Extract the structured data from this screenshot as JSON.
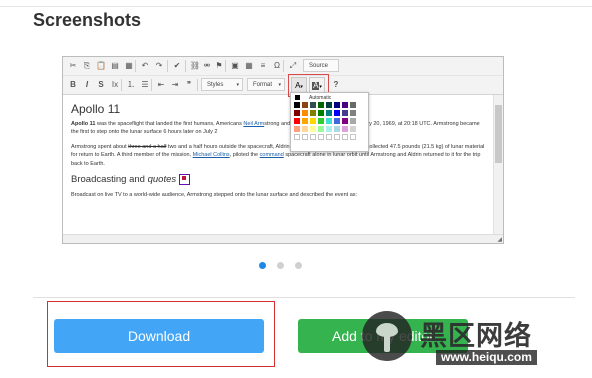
{
  "page": {
    "heading": "Screenshots"
  },
  "editor": {
    "toolbar_row1": [
      {
        "name": "cut-icon",
        "glyph": "✂"
      },
      {
        "name": "copy-icon",
        "glyph": "⎘"
      },
      {
        "name": "paste-icon",
        "glyph": "📋"
      },
      {
        "name": "paste-text-icon",
        "glyph": "▤"
      },
      {
        "name": "paste-word-icon",
        "glyph": "▦"
      },
      {
        "name": "undo-icon",
        "glyph": "↶"
      },
      {
        "name": "redo-icon",
        "glyph": "↷"
      },
      {
        "name": "spellcheck-icon",
        "glyph": "✔"
      },
      {
        "name": "link-icon",
        "glyph": "⛓"
      },
      {
        "name": "unlink-icon",
        "glyph": "⚮"
      },
      {
        "name": "anchor-icon",
        "glyph": "⚑"
      },
      {
        "name": "image-icon",
        "glyph": "▣"
      },
      {
        "name": "table-icon",
        "glyph": "▦"
      },
      {
        "name": "horizontal-line-icon",
        "glyph": "≡"
      },
      {
        "name": "special-char-icon",
        "glyph": "Ω"
      },
      {
        "name": "maximize-icon",
        "glyph": "⤢"
      }
    ],
    "source_label": "Source",
    "toolbar_row2": [
      {
        "name": "bold-icon",
        "glyph": "B"
      },
      {
        "name": "italic-icon",
        "glyph": "I"
      },
      {
        "name": "strike-icon",
        "glyph": "S"
      },
      {
        "name": "remove-format-icon",
        "glyph": "Ix"
      },
      {
        "name": "numbered-list-icon",
        "glyph": "⒈"
      },
      {
        "name": "bulleted-list-icon",
        "glyph": "☰"
      },
      {
        "name": "outdent-icon",
        "glyph": "⇤"
      },
      {
        "name": "indent-icon",
        "glyph": "⇥"
      },
      {
        "name": "blockquote-icon",
        "glyph": "❞"
      }
    ],
    "styles_label": "Styles",
    "format_label": "Format",
    "text_color_glyph": "A",
    "bg_color_glyph": "A",
    "help_glyph": "?",
    "palette": {
      "auto_label": "Automatic",
      "colors": [
        "#000000",
        "#8b4513",
        "#2f4f4f",
        "#006400",
        "#004040",
        "#000080",
        "#4b0082",
        "#696969",
        "#800000",
        "#ff8c00",
        "#808000",
        "#008000",
        "#008080",
        "#0000ff",
        "#483d8b",
        "#808080",
        "#ff0000",
        "#ffa500",
        "#ffd700",
        "#32cd32",
        "#40e0d0",
        "#4169e1",
        "#800080",
        "#a9a9a9",
        "#ffa07a",
        "#ffd59a",
        "#ffff99",
        "#98fb98",
        "#afeeee",
        "#add8e6",
        "#dda0dd",
        "#d3d3d3",
        "",
        "",
        "",
        "",
        "",
        "",
        "",
        ""
      ]
    },
    "doc": {
      "title": "Apollo 11",
      "p1_bold": "Apollo 11",
      "p1_a": " was the spaceflight that landed the first humans, Americans ",
      "p1_link1": "Neil Arm",
      "p1_b": "strong and Buzz Aldrin, on the Moon on July 20, 1969, at 20:18 UTC. Armstrong became the first to step onto the lunar surface 6 hours later on July 2",
      "p2_a": "Armstrong spent about ",
      "p2_strike": "three and a half",
      "p2_b": " two and a half hours outside the spacecraft, Aldrin slightly less; and together they collected 47.5 pounds (21.5 kg) of lunar material for return to Earth. A third member of the mission, ",
      "p2_link1": "Michael Collins",
      "p2_c": ", piloted the ",
      "p2_link2": "command",
      "p2_d": " spacecraft alone in lunar orbit until Armstrong and Aldrin returned to it for the trip back to Earth.",
      "h2_a": "Broadcasting and ",
      "h2_em": "quotes",
      "p3": "Broadcast on live TV to a world-wide audience, Armstrong stepped onto the lunar surface and described the event as:"
    }
  },
  "carousel": {
    "active_index": 0,
    "count": 3,
    "active_color": "#1e88e5",
    "inactive_color": "#d0d0d0"
  },
  "buttons": {
    "download": "Download",
    "add_to_editor": "Add to my editor"
  },
  "watermark": {
    "text": "黑区网络",
    "url": "www.heiqu.com"
  }
}
